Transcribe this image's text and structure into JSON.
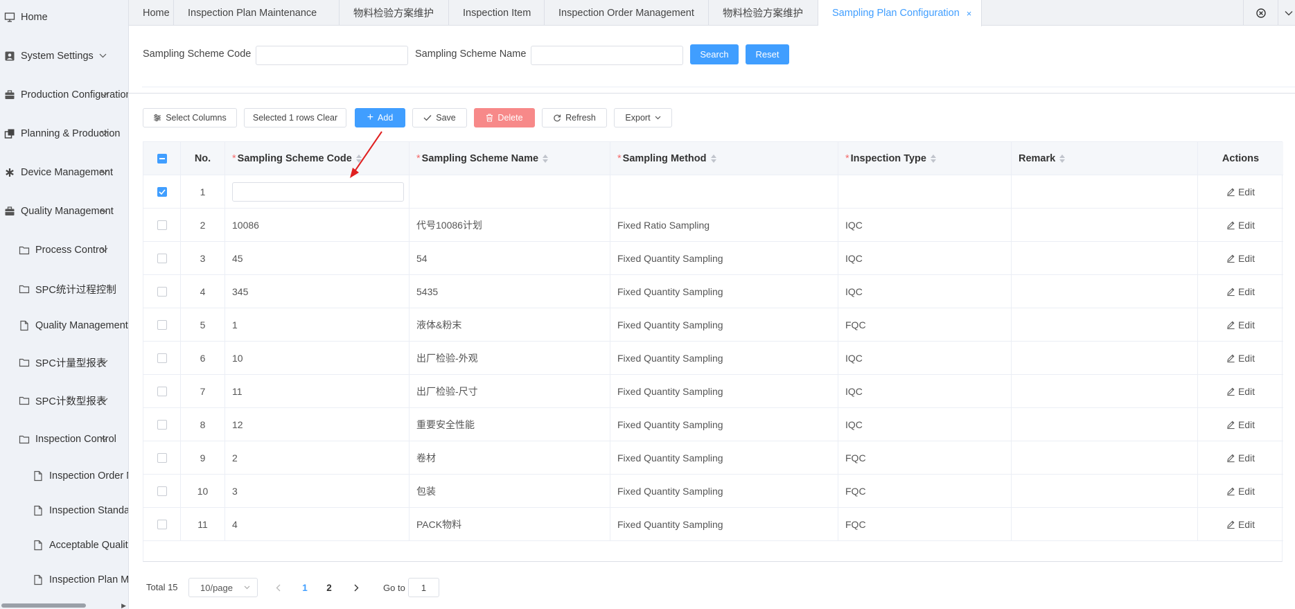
{
  "sidebar": {
    "items": [
      {
        "label": "Home",
        "icon": "monitor-icon",
        "arrow": ""
      },
      {
        "label": "System Settings",
        "icon": "user-card-icon",
        "arrow": "v"
      },
      {
        "label": "Production Configuration",
        "icon": "briefcase-icon",
        "arrow": "v"
      },
      {
        "label": "Planning & Production",
        "icon": "copy-icon",
        "arrow": "v"
      },
      {
        "label": "Device Management",
        "icon": "asterisk-icon",
        "arrow": "v"
      },
      {
        "label": "Quality Management",
        "icon": "briefcase-icon",
        "arrow": "v"
      }
    ],
    "sub_items": [
      {
        "label": "Process Control",
        "icon": "folder-icon",
        "arrow": "v"
      },
      {
        "label": "SPC统计过程控制",
        "icon": "folder-icon",
        "arrow": ""
      },
      {
        "label": "Quality Management I",
        "icon": "file-icon",
        "arrow": ""
      },
      {
        "label": "SPC计量型报表",
        "icon": "folder-icon",
        "arrow": "v"
      },
      {
        "label": "SPC计数型报表",
        "icon": "folder-icon",
        "arrow": "v"
      },
      {
        "label": "Inspection Control",
        "icon": "folder-icon",
        "arrow": "v"
      }
    ],
    "sub_sub_items": [
      {
        "label": "Inspection Order M",
        "icon": "file-icon"
      },
      {
        "label": "Inspection Standar",
        "icon": "file-icon"
      },
      {
        "label": "Acceptable Quality",
        "icon": "file-icon"
      },
      {
        "label": "Inspection Plan Ma",
        "icon": "file-icon"
      }
    ]
  },
  "tabs": [
    {
      "label": "Home",
      "active": false
    },
    {
      "label": "Inspection Plan Maintenance",
      "active": false
    },
    {
      "label": "物料检验方案维护",
      "active": false
    },
    {
      "label": "Inspection Item",
      "active": false
    },
    {
      "label": "Inspection Order Management",
      "active": false
    },
    {
      "label": "物料检验方案维护",
      "active": false
    },
    {
      "label": "Sampling Plan Configuration",
      "active": true,
      "close": "×"
    }
  ],
  "search": {
    "code_label": "Sampling Scheme Code",
    "code_value": "",
    "name_label": "Sampling Scheme Name",
    "name_value": "",
    "search_btn": "Search",
    "reset_btn": "Reset"
  },
  "toolbar": {
    "select_columns": "Select Columns",
    "selected_clear": "Selected 1 rows Clear",
    "add": "Add",
    "save": "Save",
    "delete": "Delete",
    "refresh": "Refresh",
    "export": "Export"
  },
  "table": {
    "columns": {
      "no": "No.",
      "code": "Sampling Scheme Code",
      "name": "Sampling Scheme Name",
      "method": "Sampling Method",
      "type": "Inspection Type",
      "remark": "Remark",
      "actions": "Actions"
    },
    "required_mark": "*",
    "edit_label": "Edit",
    "rows": [
      {
        "no": "1",
        "code": "",
        "name": "",
        "method": "",
        "type": "",
        "remark": "",
        "checked": true,
        "editing": true
      },
      {
        "no": "2",
        "code": "10086",
        "name": "代号10086计划",
        "method": "Fixed Ratio Sampling",
        "type": "IQC",
        "remark": ""
      },
      {
        "no": "3",
        "code": "45",
        "name": "54",
        "method": "Fixed Quantity Sampling",
        "type": "IQC",
        "remark": ""
      },
      {
        "no": "4",
        "code": "345",
        "name": "5435",
        "method": "Fixed Quantity Sampling",
        "type": "IQC",
        "remark": ""
      },
      {
        "no": "5",
        "code": "1",
        "name": "液体&粉末",
        "method": "Fixed Quantity Sampling",
        "type": "FQC",
        "remark": ""
      },
      {
        "no": "6",
        "code": "10",
        "name": "出厂检验-外观",
        "method": "Fixed Quantity Sampling",
        "type": "IQC",
        "remark": ""
      },
      {
        "no": "7",
        "code": "11",
        "name": "出厂检验-尺寸",
        "method": "Fixed Quantity Sampling",
        "type": "IQC",
        "remark": ""
      },
      {
        "no": "8",
        "code": "12",
        "name": "重要安全性能",
        "method": "Fixed Quantity Sampling",
        "type": "IQC",
        "remark": ""
      },
      {
        "no": "9",
        "code": "2",
        "name": "卷材",
        "method": "Fixed Quantity Sampling",
        "type": "FQC",
        "remark": ""
      },
      {
        "no": "10",
        "code": "3",
        "name": "包装",
        "method": "Fixed Quantity Sampling",
        "type": "FQC",
        "remark": ""
      },
      {
        "no": "11",
        "code": "4",
        "name": "PACK物料",
        "method": "Fixed Quantity Sampling",
        "type": "FQC",
        "remark": ""
      }
    ]
  },
  "pagination": {
    "total": "Total 15",
    "page_size": "10/page",
    "pages": [
      "1",
      "2"
    ],
    "current_page": "1",
    "goto_label": "Go to",
    "goto_value": "1"
  },
  "colors": {
    "primary": "#409eff",
    "danger": "#f78989",
    "required": "#f56c6c"
  }
}
